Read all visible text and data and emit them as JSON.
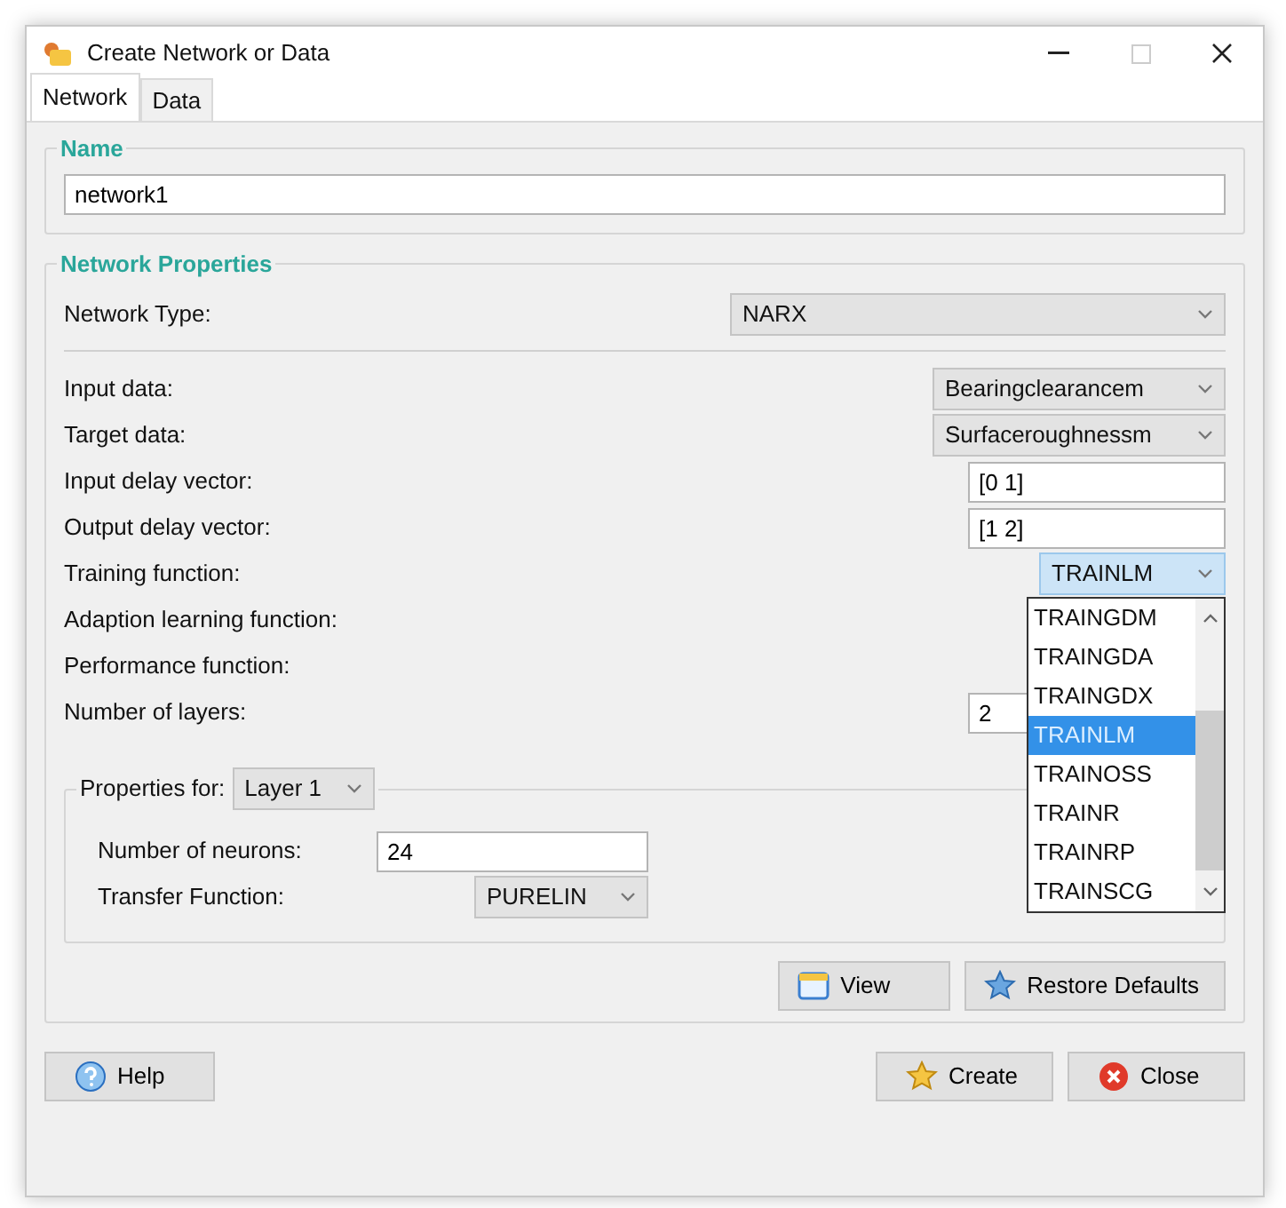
{
  "window": {
    "title": "Create Network or Data"
  },
  "tabs": [
    {
      "label": "Network",
      "selected": true
    },
    {
      "label": "Data",
      "selected": false
    }
  ],
  "name_section": {
    "legend": "Name",
    "value": "network1"
  },
  "network_properties": {
    "legend": "Network Properties",
    "network_type": {
      "label": "Network Type:",
      "value": "NARX"
    },
    "fields": [
      {
        "kind": "combo",
        "label": "Input data:",
        "value": "Bearingclearancem"
      },
      {
        "kind": "combo",
        "label": "Target data:",
        "value": "Surfaceroughnessm"
      },
      {
        "kind": "input",
        "label": "Input delay vector:",
        "value": "[0 1]"
      },
      {
        "kind": "input",
        "label": "Output delay vector:",
        "value": "[1 2]"
      },
      {
        "kind": "open",
        "label": "Training function:",
        "value": "TRAINLM"
      },
      {
        "kind": "covered",
        "label": "Adaption learning function:"
      },
      {
        "kind": "covered",
        "label": "Performance function:"
      },
      {
        "kind": "input",
        "label": "Number of layers:",
        "value": "2"
      }
    ],
    "dropdown": [
      {
        "label": "TRAINGDM",
        "selected": false
      },
      {
        "label": "TRAINGDA",
        "selected": false
      },
      {
        "label": "TRAINGDX",
        "selected": false
      },
      {
        "label": "TRAINLM",
        "selected": true
      },
      {
        "label": "TRAINOSS",
        "selected": false
      },
      {
        "label": "TRAINR",
        "selected": false
      },
      {
        "label": "TRAINRP",
        "selected": false
      },
      {
        "label": "TRAINSCG",
        "selected": false
      }
    ],
    "layer_properties": {
      "label": "Properties for:",
      "layer": "Layer 1",
      "fields": [
        {
          "kind": "input",
          "label": "Number of neurons:",
          "value": "24"
        },
        {
          "kind": "combo",
          "label": "Transfer Function:",
          "value": "PURELIN"
        }
      ]
    },
    "buttons": [
      {
        "kind": "view",
        "label": "View"
      },
      {
        "kind": "restore",
        "label": "Restore Defaults"
      }
    ]
  },
  "footer_buttons": [
    {
      "kind": "help",
      "label": "Help"
    },
    {
      "kind": "create",
      "label": "Create"
    },
    {
      "kind": "close",
      "label": "Close"
    }
  ]
}
